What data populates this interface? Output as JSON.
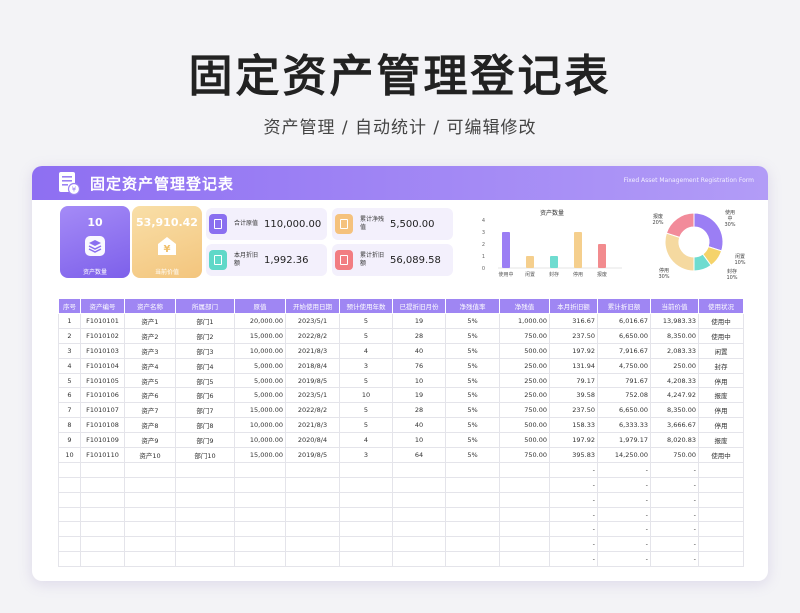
{
  "hero": {
    "title": "固定资产管理登记表",
    "subtitle": "资产管理 / 自动统计 / 可编辑修改"
  },
  "banner": {
    "title": "固定资产管理登记表",
    "subtitle_en": "Fixed Asset Management Registration Form"
  },
  "kpi_count": {
    "value": "10",
    "label": "资产数量",
    "icon": "layers-icon",
    "color": "#8a6ff0"
  },
  "kpi_value": {
    "value": "53,910.42",
    "label": "当前价值",
    "icon": "yen-icon",
    "color": "#f5cf8d"
  },
  "pills": [
    {
      "label": "合计原值",
      "value": "110,000.00",
      "color": "#8a6ff0"
    },
    {
      "label": "累计净残值",
      "value": "5,500.00",
      "color": "#f5c27d"
    },
    {
      "label": "本月折旧额",
      "value": "1,992.36",
      "color": "#5fd8c8"
    },
    {
      "label": "累计折旧额",
      "value": "56,089.58",
      "color": "#f27d82"
    }
  ],
  "chart_data": [
    {
      "type": "bar",
      "title": "资产数量",
      "categories": [
        "使用中",
        "闲置",
        "封存",
        "停用",
        "报废"
      ],
      "values": [
        3,
        1,
        1,
        3,
        2
      ],
      "ylim": [
        0,
        4
      ],
      "yticks": [
        "0",
        "1",
        "2",
        "3",
        "4"
      ],
      "colors": [
        "#9b7ef4",
        "#f5cf8d",
        "#6fdcd0",
        "#f5cf8d",
        "#f28b8e"
      ]
    },
    {
      "type": "pie",
      "categories": [
        "使用中",
        "闲置",
        "封存",
        "停用",
        "报废"
      ],
      "values": [
        30,
        10,
        10,
        30,
        20
      ],
      "labels": [
        "使用\n中\n30%",
        "闲置\n10%",
        "封存\n10%",
        "停用\n30%",
        "报废\n20%"
      ],
      "colors": [
        "#9b7ef4",
        "#f5d36a",
        "#6fdcd0",
        "#f5d9a0",
        "#f28b9a"
      ]
    }
  ],
  "table": {
    "headers": [
      "序号",
      "资产编号",
      "资产名称",
      "所属部门",
      "原值",
      "开始使用日期",
      "预计使用年数",
      "已提折旧月份",
      "净残值率",
      "净残值",
      "本月折旧额",
      "累计折旧额",
      "当前价值",
      "使用状况"
    ],
    "rows": [
      [
        "1",
        "F1010101",
        "资产1",
        "部门1",
        "20,000.00",
        "2023/5/1",
        "5",
        "19",
        "5%",
        "1,000.00",
        "316.67",
        "6,016.67",
        "13,983.33",
        "使用中"
      ],
      [
        "2",
        "F1010102",
        "资产2",
        "部门2",
        "15,000.00",
        "2022/8/2",
        "5",
        "28",
        "5%",
        "750.00",
        "237.50",
        "6,650.00",
        "8,350.00",
        "使用中"
      ],
      [
        "3",
        "F1010103",
        "资产3",
        "部门3",
        "10,000.00",
        "2021/8/3",
        "4",
        "40",
        "5%",
        "500.00",
        "197.92",
        "7,916.67",
        "2,083.33",
        "闲置"
      ],
      [
        "4",
        "F1010104",
        "资产4",
        "部门4",
        "5,000.00",
        "2018/8/4",
        "3",
        "76",
        "5%",
        "250.00",
        "131.94",
        "4,750.00",
        "250.00",
        "封存"
      ],
      [
        "5",
        "F1010105",
        "资产5",
        "部门5",
        "5,000.00",
        "2019/8/5",
        "5",
        "10",
        "5%",
        "250.00",
        "79.17",
        "791.67",
        "4,208.33",
        "停用"
      ],
      [
        "6",
        "F1010106",
        "资产6",
        "部门6",
        "5,000.00",
        "2023/5/1",
        "10",
        "19",
        "5%",
        "250.00",
        "39.58",
        "752.08",
        "4,247.92",
        "报废"
      ],
      [
        "7",
        "F1010107",
        "资产7",
        "部门7",
        "15,000.00",
        "2022/8/2",
        "5",
        "28",
        "5%",
        "750.00",
        "237.50",
        "6,650.00",
        "8,350.00",
        "停用"
      ],
      [
        "8",
        "F1010108",
        "资产8",
        "部门8",
        "10,000.00",
        "2021/8/3",
        "5",
        "40",
        "5%",
        "500.00",
        "158.33",
        "6,333.33",
        "3,666.67",
        "停用"
      ],
      [
        "9",
        "F1010109",
        "资产9",
        "部门9",
        "10,000.00",
        "2020/8/4",
        "4",
        "10",
        "5%",
        "500.00",
        "197.92",
        "1,979.17",
        "8,020.83",
        "报废"
      ],
      [
        "10",
        "F1010110",
        "资产10",
        "部门10",
        "15,000.00",
        "2019/8/5",
        "3",
        "64",
        "5%",
        "750.00",
        "395.83",
        "14,250.00",
        "750.00",
        "使用中"
      ],
      [
        "",
        "",
        "",
        "",
        "",
        "",
        "",
        "",
        "",
        "",
        "-",
        "-",
        "-",
        ""
      ],
      [
        "",
        "",
        "",
        "",
        "",
        "",
        "",
        "",
        "",
        "",
        "-",
        "-",
        "-",
        ""
      ],
      [
        "",
        "",
        "",
        "",
        "",
        "",
        "",
        "",
        "",
        "",
        "-",
        "-",
        "-",
        ""
      ],
      [
        "",
        "",
        "",
        "",
        "",
        "",
        "",
        "",
        "",
        "",
        "-",
        "-",
        "-",
        ""
      ],
      [
        "",
        "",
        "",
        "",
        "",
        "",
        "",
        "",
        "",
        "",
        "-",
        "-",
        "-",
        ""
      ],
      [
        "",
        "",
        "",
        "",
        "",
        "",
        "",
        "",
        "",
        "",
        "-",
        "-",
        "-",
        ""
      ],
      [
        "",
        "",
        "",
        "",
        "",
        "",
        "",
        "",
        "",
        "",
        "-",
        "-",
        "-",
        ""
      ]
    ]
  }
}
